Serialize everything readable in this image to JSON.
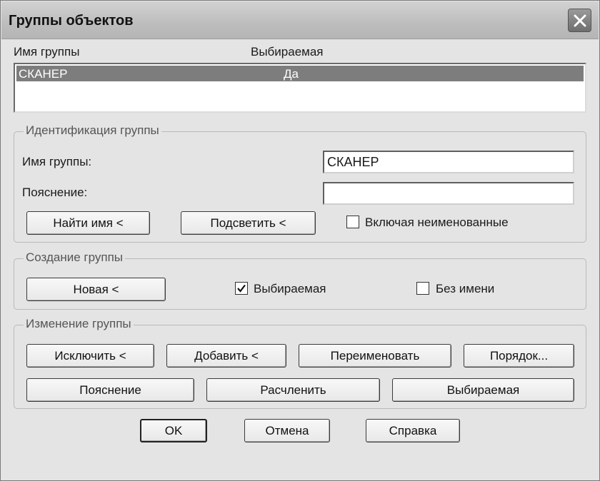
{
  "window": {
    "title": "Группы объектов"
  },
  "list": {
    "columns": [
      "Имя группы",
      "Выбираемая"
    ],
    "rows": [
      {
        "name": "СКАНЕР",
        "selectable": "Да"
      }
    ]
  },
  "identification": {
    "title": "Идентификация группы",
    "name_label": "Имя группы:",
    "name_value": "СКАНЕР",
    "description_label": "Пояснение:",
    "description_value": "",
    "find_button": "Найти имя <",
    "highlight_button": "Подсветить <",
    "include_unnamed_label": "Включая неименованные",
    "include_unnamed_checked": false
  },
  "create": {
    "title": "Создание группы",
    "new_button": "Новая <",
    "selectable_label": "Выбираемая",
    "selectable_checked": true,
    "unnamed_label": "Без имени",
    "unnamed_checked": false
  },
  "modify": {
    "title": "Изменение группы",
    "remove_button": "Исключить <",
    "add_button": "Добавить <",
    "rename_button": "Переименовать",
    "order_button": "Порядок...",
    "description_button": "Пояснение",
    "explode_button": "Расчленить",
    "selectable_button": "Выбираемая"
  },
  "footer": {
    "ok": "OK",
    "cancel": "Отмена",
    "help": "Справка"
  },
  "icons": {
    "close": "close-icon",
    "check": "checkmark-icon"
  }
}
